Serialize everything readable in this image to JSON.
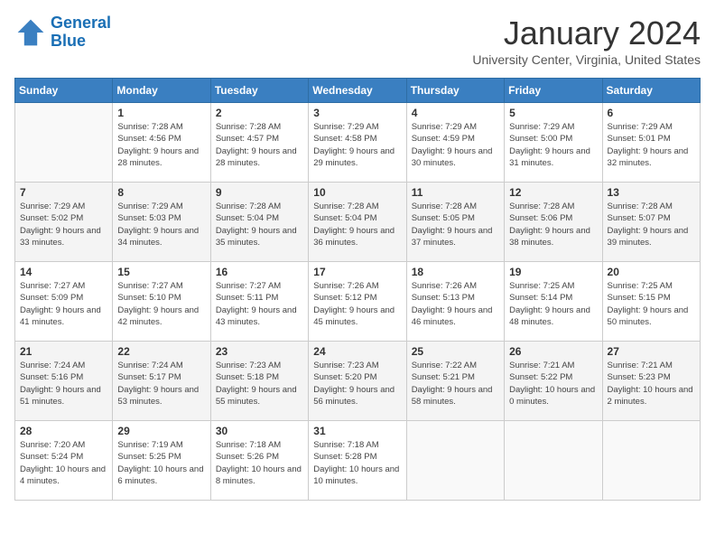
{
  "logo": {
    "line1": "General",
    "line2": "Blue"
  },
  "title": "January 2024",
  "subtitle": "University Center, Virginia, United States",
  "weekdays": [
    "Sunday",
    "Monday",
    "Tuesday",
    "Wednesday",
    "Thursday",
    "Friday",
    "Saturday"
  ],
  "weeks": [
    [
      {
        "num": "",
        "sunrise": "",
        "sunset": "",
        "daylight": ""
      },
      {
        "num": "1",
        "sunrise": "Sunrise: 7:28 AM",
        "sunset": "Sunset: 4:56 PM",
        "daylight": "Daylight: 9 hours and 28 minutes."
      },
      {
        "num": "2",
        "sunrise": "Sunrise: 7:28 AM",
        "sunset": "Sunset: 4:57 PM",
        "daylight": "Daylight: 9 hours and 28 minutes."
      },
      {
        "num": "3",
        "sunrise": "Sunrise: 7:29 AM",
        "sunset": "Sunset: 4:58 PM",
        "daylight": "Daylight: 9 hours and 29 minutes."
      },
      {
        "num": "4",
        "sunrise": "Sunrise: 7:29 AM",
        "sunset": "Sunset: 4:59 PM",
        "daylight": "Daylight: 9 hours and 30 minutes."
      },
      {
        "num": "5",
        "sunrise": "Sunrise: 7:29 AM",
        "sunset": "Sunset: 5:00 PM",
        "daylight": "Daylight: 9 hours and 31 minutes."
      },
      {
        "num": "6",
        "sunrise": "Sunrise: 7:29 AM",
        "sunset": "Sunset: 5:01 PM",
        "daylight": "Daylight: 9 hours and 32 minutes."
      }
    ],
    [
      {
        "num": "7",
        "sunrise": "Sunrise: 7:29 AM",
        "sunset": "Sunset: 5:02 PM",
        "daylight": "Daylight: 9 hours and 33 minutes."
      },
      {
        "num": "8",
        "sunrise": "Sunrise: 7:29 AM",
        "sunset": "Sunset: 5:03 PM",
        "daylight": "Daylight: 9 hours and 34 minutes."
      },
      {
        "num": "9",
        "sunrise": "Sunrise: 7:28 AM",
        "sunset": "Sunset: 5:04 PM",
        "daylight": "Daylight: 9 hours and 35 minutes."
      },
      {
        "num": "10",
        "sunrise": "Sunrise: 7:28 AM",
        "sunset": "Sunset: 5:04 PM",
        "daylight": "Daylight: 9 hours and 36 minutes."
      },
      {
        "num": "11",
        "sunrise": "Sunrise: 7:28 AM",
        "sunset": "Sunset: 5:05 PM",
        "daylight": "Daylight: 9 hours and 37 minutes."
      },
      {
        "num": "12",
        "sunrise": "Sunrise: 7:28 AM",
        "sunset": "Sunset: 5:06 PM",
        "daylight": "Daylight: 9 hours and 38 minutes."
      },
      {
        "num": "13",
        "sunrise": "Sunrise: 7:28 AM",
        "sunset": "Sunset: 5:07 PM",
        "daylight": "Daylight: 9 hours and 39 minutes."
      }
    ],
    [
      {
        "num": "14",
        "sunrise": "Sunrise: 7:27 AM",
        "sunset": "Sunset: 5:09 PM",
        "daylight": "Daylight: 9 hours and 41 minutes."
      },
      {
        "num": "15",
        "sunrise": "Sunrise: 7:27 AM",
        "sunset": "Sunset: 5:10 PM",
        "daylight": "Daylight: 9 hours and 42 minutes."
      },
      {
        "num": "16",
        "sunrise": "Sunrise: 7:27 AM",
        "sunset": "Sunset: 5:11 PM",
        "daylight": "Daylight: 9 hours and 43 minutes."
      },
      {
        "num": "17",
        "sunrise": "Sunrise: 7:26 AM",
        "sunset": "Sunset: 5:12 PM",
        "daylight": "Daylight: 9 hours and 45 minutes."
      },
      {
        "num": "18",
        "sunrise": "Sunrise: 7:26 AM",
        "sunset": "Sunset: 5:13 PM",
        "daylight": "Daylight: 9 hours and 46 minutes."
      },
      {
        "num": "19",
        "sunrise": "Sunrise: 7:25 AM",
        "sunset": "Sunset: 5:14 PM",
        "daylight": "Daylight: 9 hours and 48 minutes."
      },
      {
        "num": "20",
        "sunrise": "Sunrise: 7:25 AM",
        "sunset": "Sunset: 5:15 PM",
        "daylight": "Daylight: 9 hours and 50 minutes."
      }
    ],
    [
      {
        "num": "21",
        "sunrise": "Sunrise: 7:24 AM",
        "sunset": "Sunset: 5:16 PM",
        "daylight": "Daylight: 9 hours and 51 minutes."
      },
      {
        "num": "22",
        "sunrise": "Sunrise: 7:24 AM",
        "sunset": "Sunset: 5:17 PM",
        "daylight": "Daylight: 9 hours and 53 minutes."
      },
      {
        "num": "23",
        "sunrise": "Sunrise: 7:23 AM",
        "sunset": "Sunset: 5:18 PM",
        "daylight": "Daylight: 9 hours and 55 minutes."
      },
      {
        "num": "24",
        "sunrise": "Sunrise: 7:23 AM",
        "sunset": "Sunset: 5:20 PM",
        "daylight": "Daylight: 9 hours and 56 minutes."
      },
      {
        "num": "25",
        "sunrise": "Sunrise: 7:22 AM",
        "sunset": "Sunset: 5:21 PM",
        "daylight": "Daylight: 9 hours and 58 minutes."
      },
      {
        "num": "26",
        "sunrise": "Sunrise: 7:21 AM",
        "sunset": "Sunset: 5:22 PM",
        "daylight": "Daylight: 10 hours and 0 minutes."
      },
      {
        "num": "27",
        "sunrise": "Sunrise: 7:21 AM",
        "sunset": "Sunset: 5:23 PM",
        "daylight": "Daylight: 10 hours and 2 minutes."
      }
    ],
    [
      {
        "num": "28",
        "sunrise": "Sunrise: 7:20 AM",
        "sunset": "Sunset: 5:24 PM",
        "daylight": "Daylight: 10 hours and 4 minutes."
      },
      {
        "num": "29",
        "sunrise": "Sunrise: 7:19 AM",
        "sunset": "Sunset: 5:25 PM",
        "daylight": "Daylight: 10 hours and 6 minutes."
      },
      {
        "num": "30",
        "sunrise": "Sunrise: 7:18 AM",
        "sunset": "Sunset: 5:26 PM",
        "daylight": "Daylight: 10 hours and 8 minutes."
      },
      {
        "num": "31",
        "sunrise": "Sunrise: 7:18 AM",
        "sunset": "Sunset: 5:28 PM",
        "daylight": "Daylight: 10 hours and 10 minutes."
      },
      {
        "num": "",
        "sunrise": "",
        "sunset": "",
        "daylight": ""
      },
      {
        "num": "",
        "sunrise": "",
        "sunset": "",
        "daylight": ""
      },
      {
        "num": "",
        "sunrise": "",
        "sunset": "",
        "daylight": ""
      }
    ]
  ]
}
